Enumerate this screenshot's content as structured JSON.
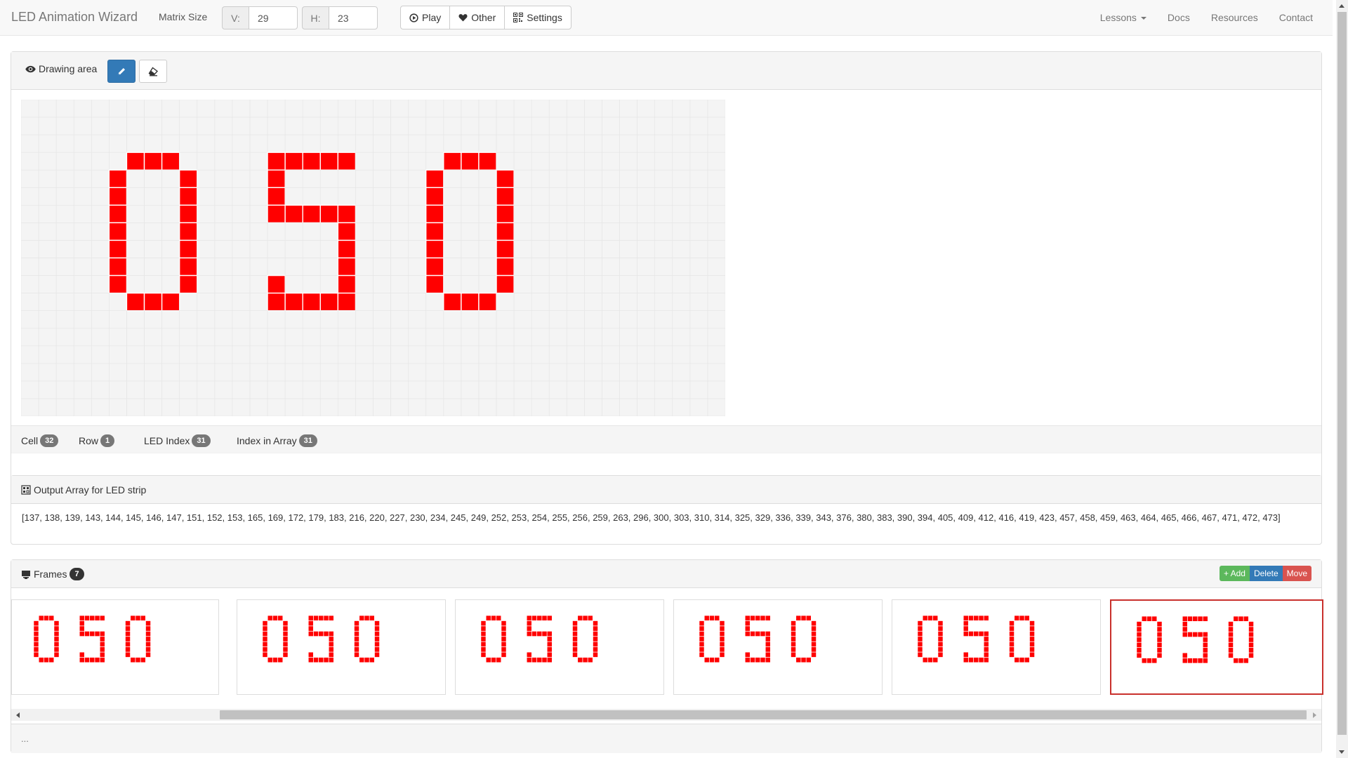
{
  "navbar": {
    "brand": "LED Animation Wizard",
    "matrix_label": "Matrix Size",
    "v_label": "V:",
    "v_value": "29",
    "h_label": "H:",
    "h_value": "23",
    "play_label": "Play",
    "other_label": "Other",
    "settings_label": "Settings",
    "links": {
      "lessons": "Lessons",
      "docs": "Docs",
      "resources": "Resources",
      "contact": "Contact"
    }
  },
  "drawing": {
    "title": "Drawing area",
    "active_tool": "pencil",
    "matrix": {
      "rows": 18,
      "cols": 40,
      "on_color": "#ff0000",
      "grid_bg": "#f4f4f4",
      "grid_line": "#e6e6e6"
    },
    "pattern": [
      "........................................",
      "........................................",
      "........................................",
      "......***.....*****.....***.............",
      ".....*...*....*........*...*............",
      ".....*...*....*........*...*............",
      ".....*...*....*****....*...*............",
      ".....*...*........*....*...*............",
      ".....*...*........*....*...*............",
      ".....*...*........*....*...*............",
      ".....*...*....*...*....*...*............",
      "......***.....*****.....***.............",
      "........................................",
      "........................................",
      "........................................",
      "........................................",
      "........................................",
      "........................................"
    ]
  },
  "info": {
    "cell_label": "Cell",
    "cell_value": "32",
    "row_label": "Row",
    "row_value": "1",
    "led_label": "LED Index",
    "led_value": "31",
    "idx_label": "Index in Array",
    "idx_value": "31"
  },
  "output": {
    "title": "Output Array for LED strip",
    "text": "[137, 138, 139, 143, 144, 145, 146, 147, 151, 152, 153, 165, 169, 172, 179, 183, 216, 220, 227, 230, 234, 245, 249, 252, 253, 254, 255, 256, 259, 263, 296, 300, 303, 310, 314, 325, 329, 336, 339, 343, 376, 380, 383, 390, 394, 405, 409, 412, 416, 419, 423, 457, 458, 459, 463, 464, 465, 466, 467, 471, 472, 473]"
  },
  "frames": {
    "title": "Frames",
    "count": "7",
    "add_label": "+ Add",
    "delete_label": "Delete",
    "move_label": "Move",
    "selected_index": 5,
    "visible_frames": 6,
    "footer": "..."
  },
  "icons": {
    "eye": "eye-icon",
    "pencil": "pencil-icon",
    "eraser": "eraser-icon",
    "play": "play-circle-icon",
    "heart": "heart-icon",
    "qr": "qrcode-icon",
    "output": "output-icon",
    "frames": "frames-icon"
  },
  "colors": {
    "led_on": "#ff0000",
    "primary": "#337ab7",
    "success": "#5cb85c",
    "danger": "#d9534f"
  }
}
